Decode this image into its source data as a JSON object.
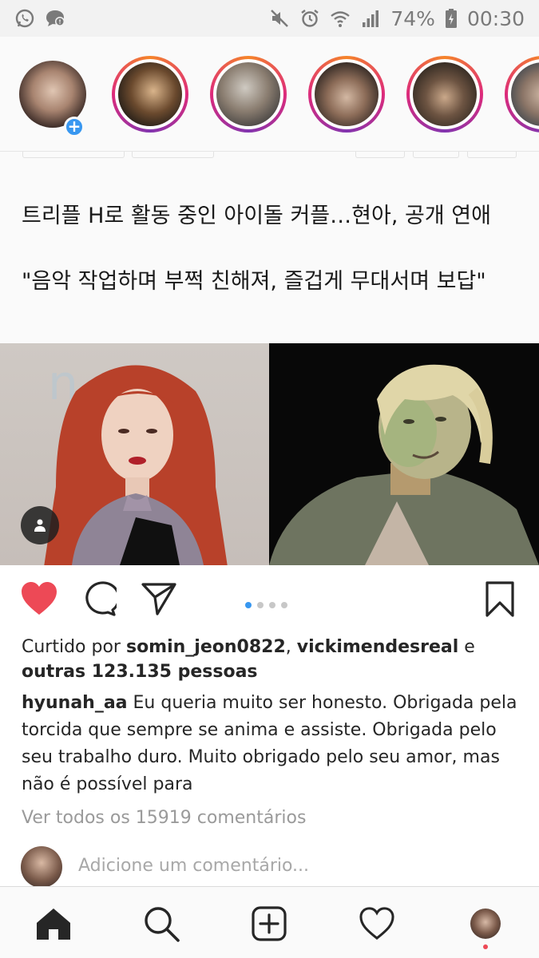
{
  "status_bar": {
    "battery": "74%",
    "time": "00:30",
    "icons": [
      "whatsapp-icon",
      "chat-icon",
      "mute-icon",
      "alarm-icon",
      "wifi-icon",
      "signal-icon",
      "battery-icon"
    ]
  },
  "stories": {
    "items": [
      {
        "kind": "own",
        "has_add_badge": true
      },
      {
        "kind": "unseen"
      },
      {
        "kind": "unseen"
      },
      {
        "kind": "unseen"
      },
      {
        "kind": "unseen"
      },
      {
        "kind": "unseen"
      }
    ]
  },
  "post": {
    "headline_1": "트리플 H로 활동 중인 아이돌 커플…현아, 공개 연애",
    "headline_2": "\"음악 작업하며 부쩍 친해져, 즐겁게 무대서며 보답\"",
    "carousel": {
      "count": 4,
      "active": 1
    },
    "likes_prefix": "Curtido por ",
    "liker_1": "somin_jeon0822",
    "likes_sep": ", ",
    "liker_2": "vickimendesreal",
    "likes_and": " e",
    "likes_others": "outras 123.135 pessoas",
    "caption_user": "hyunah_aa",
    "caption_text": " Eu queria muito ser honesto. Obrigada pela torcida que sempre se anima e assiste. Obrigada pelo seu trabalho duro. Muito obrigado pelo seu amor, mas não é possível para",
    "view_all_comments": "Ver todos os 15919 comentários",
    "comment_placeholder": "Adicione um comentário...",
    "liked": true
  },
  "colors": {
    "like_red": "#ed4956",
    "accent_blue": "#3897f0",
    "status_bar_bg": "#f2f2f2"
  },
  "bottom_nav": {
    "items": [
      "home-icon",
      "search-icon",
      "new-post-icon",
      "activity-heart-icon",
      "profile-avatar"
    ],
    "active": "home-icon",
    "profile_notification": true
  }
}
